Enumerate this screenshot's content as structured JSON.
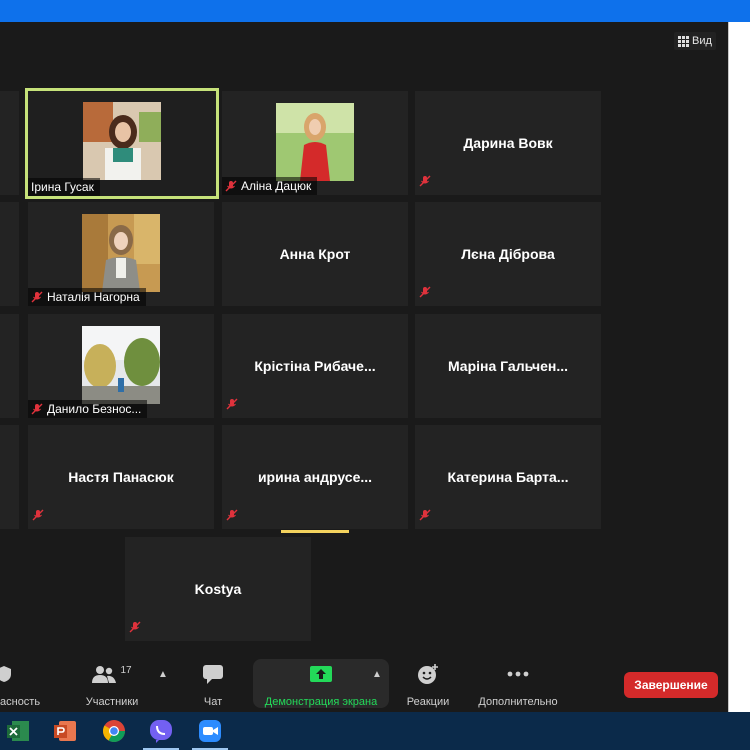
{
  "view": {
    "label": "Вид"
  },
  "tiles": [
    {
      "name": "Ірина Гусак",
      "has_video": true,
      "active": true,
      "muted": false
    },
    {
      "name": "Аліна Дацюк",
      "has_video": true,
      "active": false,
      "muted": true
    },
    {
      "name": "Дарина Вовк",
      "has_video": false,
      "active": false,
      "muted": true
    },
    {
      "name": "Наталія Нагорна",
      "has_video": true,
      "active": false,
      "muted": true
    },
    {
      "name": "Анна Крот",
      "has_video": false,
      "active": false,
      "muted": false
    },
    {
      "name": "Лєна Діброва",
      "has_video": false,
      "active": false,
      "muted": true
    },
    {
      "name": "Данило Безнос...",
      "has_video": true,
      "active": false,
      "muted": true
    },
    {
      "name": "Крістіна  Рибаче...",
      "has_video": false,
      "active": false,
      "muted": true
    },
    {
      "name": "Маріна  Гальчен...",
      "has_video": false,
      "active": false,
      "muted": false
    },
    {
      "name": "Настя Панасюк",
      "has_video": false,
      "active": false,
      "muted": true
    },
    {
      "name": "ирина  андрусе...",
      "has_video": false,
      "active": false,
      "muted": true
    },
    {
      "name": "Катерина  Барта...",
      "has_video": false,
      "active": false,
      "muted": true
    },
    {
      "name": "Kostya",
      "has_video": false,
      "active": false,
      "muted": true
    }
  ],
  "toolbar": {
    "security_label": "асность",
    "participants_label": "Участники",
    "participants_count": "17",
    "chat_label": "Чат",
    "share_label": "Демонстрация экрана",
    "reactions_label": "Реакции",
    "more_label": "Дополнительно",
    "end_label": "Завершение"
  },
  "colors": {
    "accent": "#0e71eb",
    "active_border": "#c6e27a",
    "share_green": "#23d959",
    "end_red": "#d42a2a",
    "mute_red": "#e0323c"
  },
  "taskbar": {
    "apps": [
      "excel-icon",
      "powerpoint-icon",
      "chrome-icon",
      "viber-icon",
      "zoom-icon"
    ]
  }
}
